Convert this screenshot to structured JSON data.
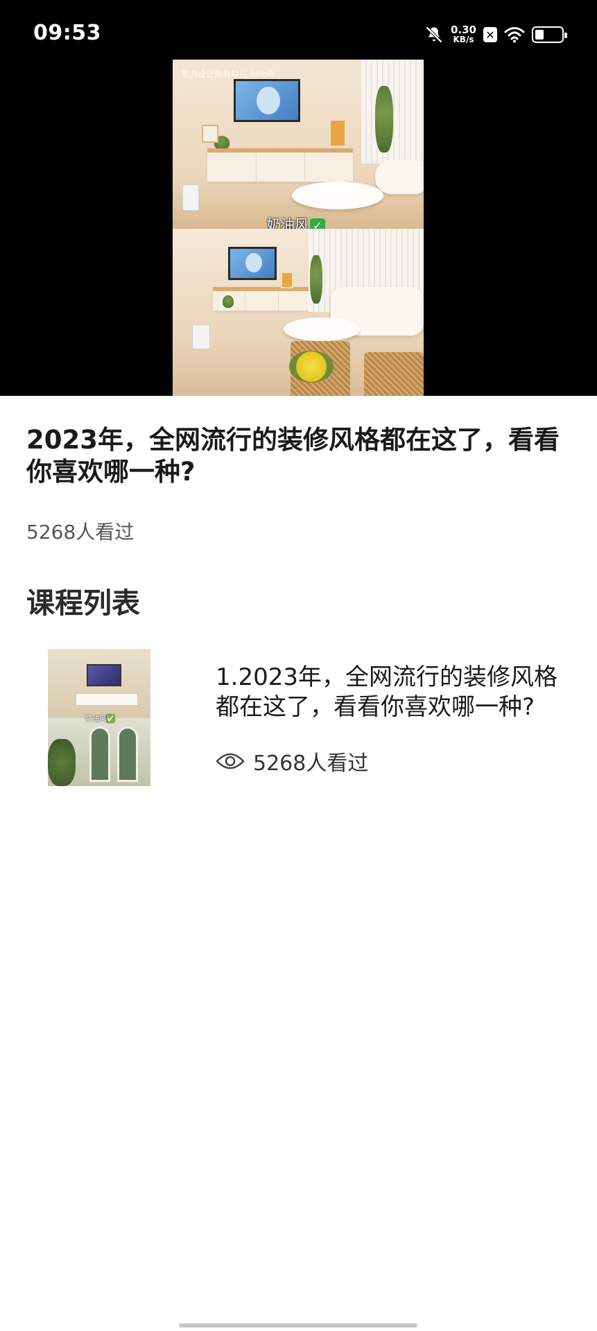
{
  "status_bar": {
    "time": "09:53",
    "net_speed_value": "0.30",
    "net_speed_unit": "KB/s",
    "icons": [
      "bell-off-icon",
      "sim-disabled-icon",
      "wifi-icon",
      "battery-icon"
    ]
  },
  "video": {
    "watermark": "室内设计师有料儿 bilibili",
    "caption": "奶油风",
    "caption_badge": "✅"
  },
  "detail": {
    "title": "2023年，全网流行的装修风格都在这了，看看你喜欢哪一种?",
    "views": "5268人看过"
  },
  "course_list": {
    "heading": "课程列表",
    "items": [
      {
        "title": "1.2023年，全网流行的装修风格都在这了，看看你喜欢哪一种?",
        "views": "5268人看过",
        "thumb_caption": "奶油风✅",
        "icon": "eye-icon"
      }
    ]
  }
}
